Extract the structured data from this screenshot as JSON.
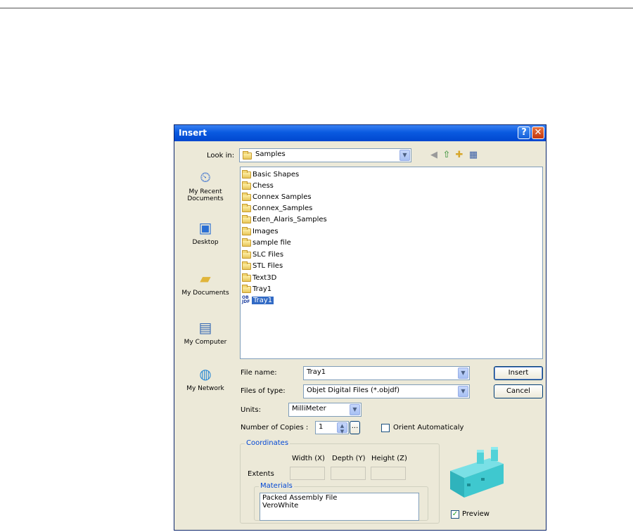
{
  "window": {
    "title": "Insert",
    "help_label": "?",
    "close_label": "✕"
  },
  "look_in": {
    "label": "Look in:",
    "value": "Samples"
  },
  "toolbar_icons": [
    "back-icon",
    "up-folder-icon",
    "new-folder-icon",
    "view-menu-icon"
  ],
  "places": [
    {
      "label_line1": "My Recent",
      "label_line2": "Documents",
      "icon": "recent-documents-icon"
    },
    {
      "label_line1": "Desktop",
      "label_line2": "",
      "icon": "desktop-icon"
    },
    {
      "label_line1": "My Documents",
      "label_line2": "",
      "icon": "my-documents-icon"
    },
    {
      "label_line1": "My Computer",
      "label_line2": "",
      "icon": "my-computer-icon"
    },
    {
      "label_line1": "My Network",
      "label_line2": "",
      "icon": "my-network-icon"
    }
  ],
  "files": [
    {
      "name": "Basic Shapes",
      "type": "folder"
    },
    {
      "name": "Chess",
      "type": "folder"
    },
    {
      "name": "Connex Samples",
      "type": "folder"
    },
    {
      "name": "Connex_Samples",
      "type": "folder"
    },
    {
      "name": "Eden_Alaris_Samples",
      "type": "folder"
    },
    {
      "name": "Images",
      "type": "folder"
    },
    {
      "name": "sample file",
      "type": "folder"
    },
    {
      "name": "SLC Files",
      "type": "folder"
    },
    {
      "name": "STL Files",
      "type": "folder"
    },
    {
      "name": "Text3D",
      "type": "folder"
    },
    {
      "name": "Tray1",
      "type": "folder"
    },
    {
      "name": "Tray1",
      "type": "objdf",
      "selected": true,
      "icon_text": "OB\nJDF"
    }
  ],
  "file_name": {
    "label": "File name:",
    "value": "Tray1"
  },
  "files_of_type": {
    "label": "Files of type:",
    "value": "Objet Digital Files (*.objdf)"
  },
  "buttons": {
    "insert": "Insert",
    "cancel": "Cancel"
  },
  "units": {
    "label": "Units:",
    "value": "MilliMeter"
  },
  "copies": {
    "label": "Number of Copies :",
    "value": "1",
    "more_label": "..."
  },
  "orient": {
    "label": "Orient Automaticaly",
    "checked": false
  },
  "coordinates": {
    "group_label": "Coordinates",
    "width_label": "Width (X)",
    "depth_label": "Depth (Y)",
    "height_label": "Height (Z)",
    "extents_label": "Extents"
  },
  "materials": {
    "group_label": "Materials",
    "items": [
      "Packed Assembly File",
      "VeroWhite"
    ]
  },
  "preview": {
    "label": "Preview",
    "checked": true,
    "check_mark": "✓",
    "model_color": "#3fc8cf"
  },
  "colors": {
    "titlebar": "#0a5ae0",
    "dialog_bg": "#ece9d8",
    "selection": "#316ac5"
  }
}
